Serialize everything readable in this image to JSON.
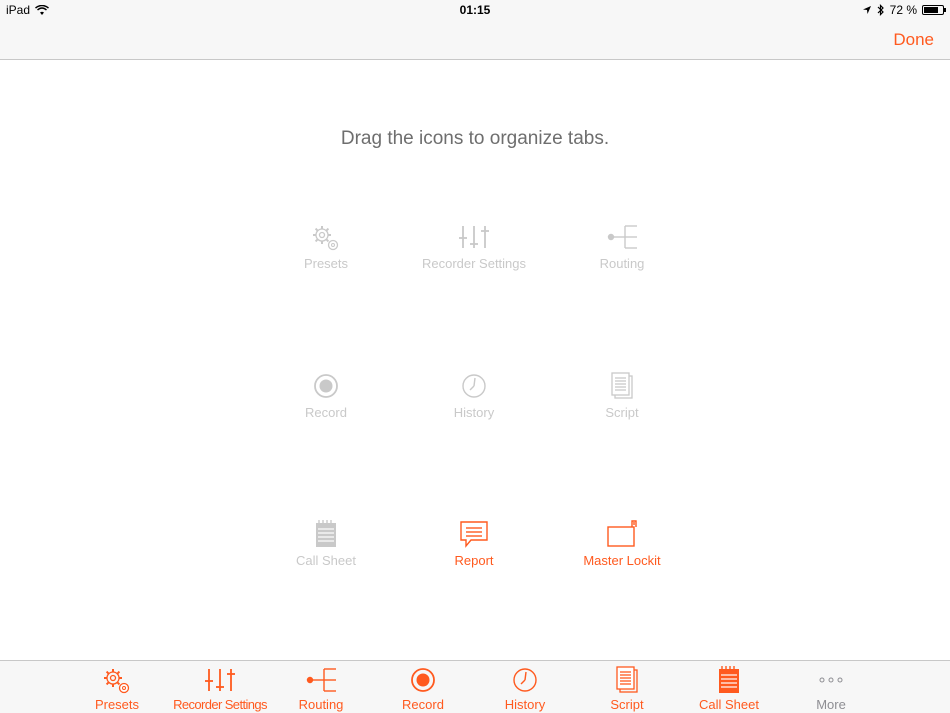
{
  "status_bar": {
    "device": "iPad",
    "time": "01:15",
    "battery": "72 %",
    "battery_level": 0.72
  },
  "nav": {
    "done_label": "Done"
  },
  "instruction": "Drag the icons to organize tabs.",
  "grid": [
    {
      "label": "Presets",
      "icon": "gear-icon",
      "state": "disabled"
    },
    {
      "label": "Recorder Settings",
      "icon": "sliders-icon",
      "state": "disabled"
    },
    {
      "label": "Routing",
      "icon": "routing-icon",
      "state": "disabled"
    },
    {
      "label": "Record",
      "icon": "record-icon",
      "state": "disabled"
    },
    {
      "label": "History",
      "icon": "clock-icon",
      "state": "disabled"
    },
    {
      "label": "Script",
      "icon": "script-icon",
      "state": "disabled"
    },
    {
      "label": "Call Sheet",
      "icon": "notepad-icon",
      "state": "disabled"
    },
    {
      "label": "Report",
      "icon": "report-icon",
      "state": "active"
    },
    {
      "label": "Master Lockit",
      "icon": "lockit-icon",
      "state": "active"
    }
  ],
  "tabs": [
    {
      "label": "Presets",
      "icon": "gear-icon"
    },
    {
      "label": "Recorder Settings",
      "icon": "sliders-icon"
    },
    {
      "label": "Routing",
      "icon": "routing-icon"
    },
    {
      "label": "Record",
      "icon": "record-icon"
    },
    {
      "label": "History",
      "icon": "clock-icon"
    },
    {
      "label": "Script",
      "icon": "script-icon"
    },
    {
      "label": "Call Sheet",
      "icon": "notepad-icon"
    },
    {
      "label": "More",
      "icon": "more-icon"
    }
  ],
  "colors": {
    "accent": "#ff5a1f",
    "disabled": "#c9c9c9"
  }
}
